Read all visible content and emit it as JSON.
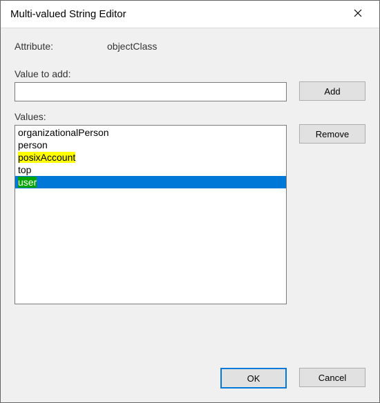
{
  "window": {
    "title": "Multi-valued String Editor"
  },
  "attribute": {
    "label": "Attribute:",
    "value": "objectClass"
  },
  "value_to_add": {
    "label": "Value to add:",
    "input_value": ""
  },
  "buttons": {
    "add": "Add",
    "remove": "Remove",
    "ok": "OK",
    "cancel": "Cancel"
  },
  "values": {
    "label": "Values:",
    "items": [
      {
        "text": "organizationalPerson",
        "highlight": "none",
        "selected": false
      },
      {
        "text": "person",
        "highlight": "none",
        "selected": false
      },
      {
        "text": "posixAccount",
        "highlight": "yellow",
        "selected": false
      },
      {
        "text": "top",
        "highlight": "none",
        "selected": false
      },
      {
        "text": "user",
        "highlight": "green",
        "selected": true
      }
    ]
  },
  "icons": {
    "close": "close-icon"
  }
}
